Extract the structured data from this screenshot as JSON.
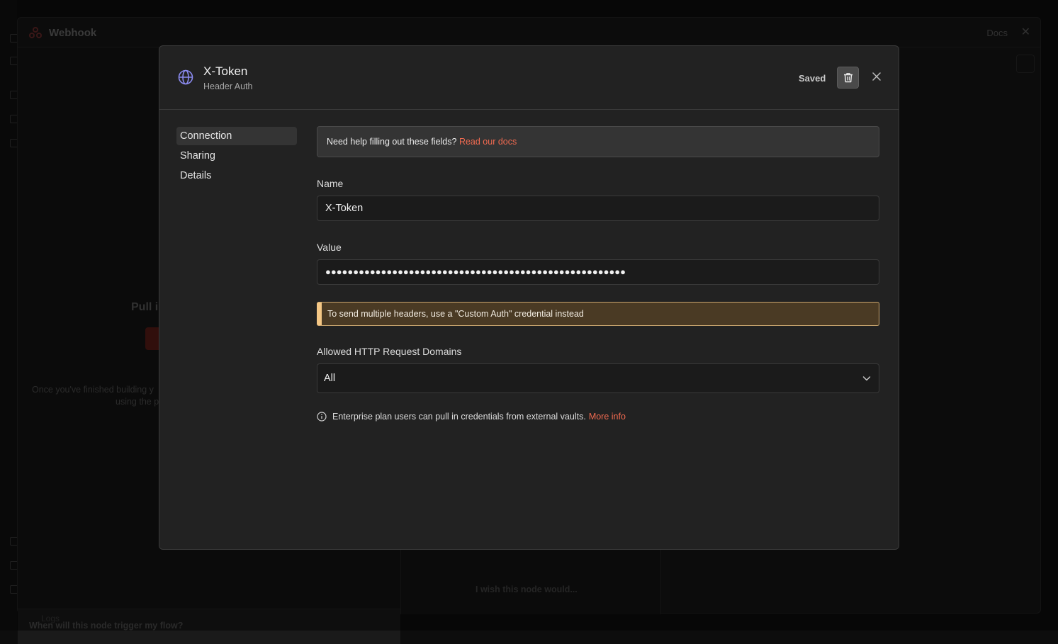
{
  "background": {
    "window_title": "Webhook",
    "docs_label": "Docs",
    "pull_text": "Pull i",
    "text_line1": "Once you've finished building y",
    "text_line2": "using the p",
    "trigger_question": "When will this node trigger my flow?",
    "wish_text": "I wish this node would...",
    "logs_label": "Logs"
  },
  "modal": {
    "title": "X-Token",
    "subtitle": "Header Auth",
    "saved_label": "Saved",
    "nav": [
      {
        "label": "Connection",
        "active": true
      },
      {
        "label": "Sharing",
        "active": false
      },
      {
        "label": "Details",
        "active": false
      }
    ],
    "help": {
      "text": "Need help filling out these fields?",
      "link": "Read our docs"
    },
    "name_field": {
      "label": "Name",
      "value": "X-Token"
    },
    "value_field": {
      "label": "Value",
      "masked_value": "●●●●●●●●●●●●●●●●●●●●●●●●●●●●●●●●●●●●●●●●●●●●●●●●●●●●●●"
    },
    "warning": "To send multiple headers, use a \"Custom Auth\" credential instead",
    "domains_field": {
      "label": "Allowed HTTP Request Domains",
      "selected": "All"
    },
    "info": {
      "text": "Enterprise plan users can pull in credentials from external vaults.",
      "link": "More info"
    }
  },
  "colors": {
    "accent_link": "#f06a50",
    "warning_border": "#f4c785",
    "globe_icon": "#8b8bf0"
  }
}
